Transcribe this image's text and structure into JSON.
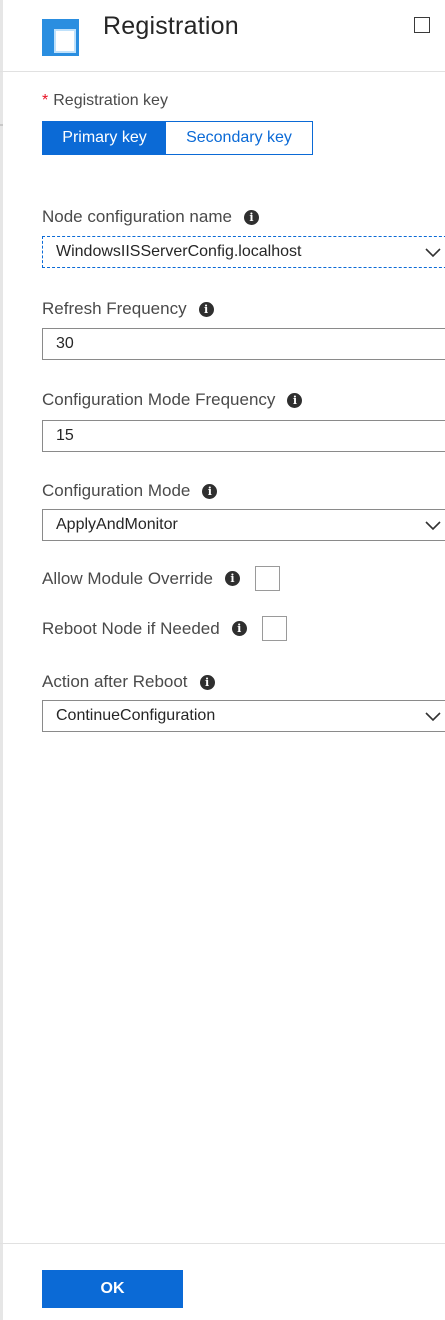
{
  "header": {
    "title": "Registration",
    "icon": "blade-icon",
    "maximize_icon": "maximize-icon"
  },
  "registration_key": {
    "label": "Registration key",
    "required_marker": "*",
    "options": [
      "Primary key",
      "Secondary key"
    ],
    "selected": "Primary key"
  },
  "fields": {
    "node_config": {
      "label": "Node configuration name",
      "value": "WindowsIISServerConfig.localhost"
    },
    "refresh_frequency": {
      "label": "Refresh Frequency",
      "value": "30"
    },
    "config_mode_frequency": {
      "label": "Configuration Mode Frequency",
      "value": "15"
    },
    "config_mode": {
      "label": "Configuration Mode",
      "value": "ApplyAndMonitor"
    },
    "allow_module_override": {
      "label": "Allow Module Override",
      "checked": false
    },
    "reboot_node": {
      "label": "Reboot Node if Needed",
      "checked": false
    },
    "action_after_reboot": {
      "label": "Action after Reboot",
      "value": "ContinueConfiguration"
    }
  },
  "info_glyph": "i",
  "footer": {
    "ok_label": "OK"
  },
  "colors": {
    "accent": "#0b6ad6",
    "required": "#e81123",
    "text": "#323232",
    "border": "#8a8a8a"
  }
}
